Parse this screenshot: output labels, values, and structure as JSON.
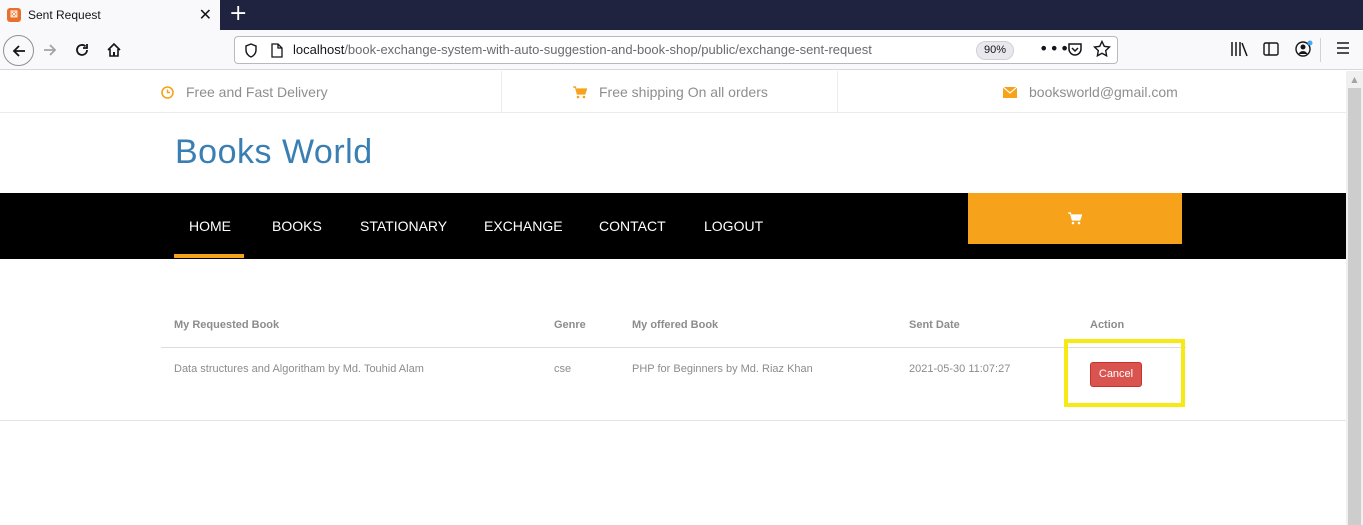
{
  "browser": {
    "tab_title": "Sent Request",
    "tab_close": "✕",
    "new_tab": "+",
    "url_host": "localhost",
    "url_path": "/book-exchange-system-with-auto-suggestion-and-book-shop/public/exchange-sent-request",
    "zoom": "90%",
    "more_label": "•••"
  },
  "topbar": {
    "delivery": "Free and Fast Delivery",
    "shipping": "Free shipping On all orders",
    "email": "booksworld@gmail.com"
  },
  "brand": "Books World",
  "menu": {
    "home": "HOME",
    "books": "BOOKS",
    "stationary": "STATIONARY",
    "exchange": "EXCHANGE",
    "contact": "CONTACT",
    "logout": "LOGOUT"
  },
  "table": {
    "headers": {
      "requested": "My Requested Book",
      "genre": "Genre",
      "offered": "My offered Book",
      "date": "Sent Date",
      "action": "Action"
    },
    "rows": [
      {
        "requested": "Data structures and Algoritham by Md. Touhid Alam",
        "genre": "cse",
        "offered": "PHP for Beginners by Md. Riaz Khan",
        "date": "2021-05-30 11:07:27",
        "action": "Cancel"
      }
    ]
  },
  "colors": {
    "accent": "#f7a21b",
    "brand": "#3a7fb4",
    "danger": "#d9534f",
    "highlight": "#f7ea12"
  }
}
